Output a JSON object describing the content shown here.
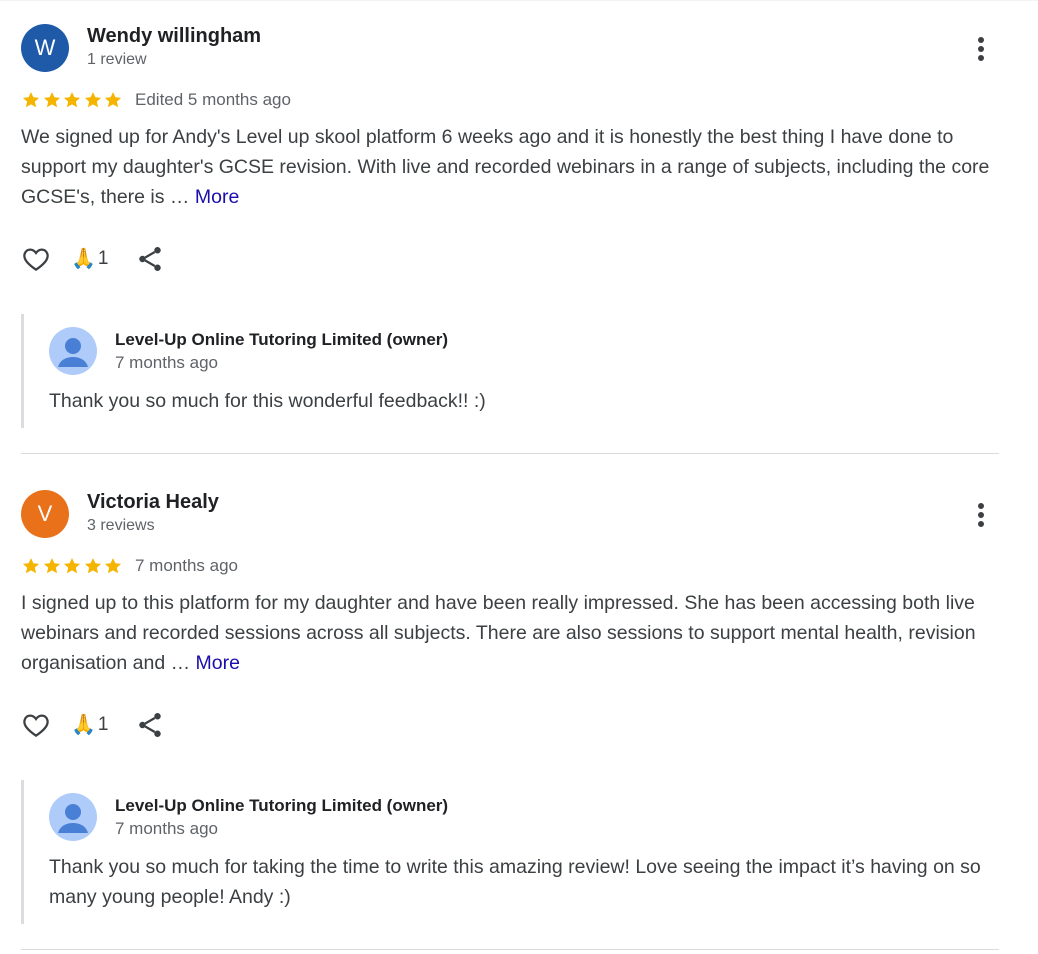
{
  "colors": {
    "star": "#f4b400",
    "link": "#1a0dab",
    "avatar_w": "#1e5aa8",
    "avatar_v": "#e8711a",
    "owner_avatar_bg": "#aecbfa",
    "owner_avatar_fg": "#4a7fd6"
  },
  "icons": [
    "star-icon",
    "heart-icon",
    "pray-icon",
    "share-icon",
    "more-vert-icon",
    "person-icon"
  ],
  "reviews": [
    {
      "initial": "W",
      "name": "Wendy willingham",
      "review_count": "1 review",
      "rating": 5,
      "date": "Edited 5 months ago",
      "text": "We signed up for Andy's Level up skool platform 6 weeks ago and it is honestly the best thing I have done to support my daughter's GCSE revision. With live and recorded webinars in a range of subjects, including the core GCSE's, there is …",
      "more": "More",
      "reaction_emoji": "🙏",
      "reaction_count": "1",
      "reply": {
        "name": "Level-Up Online Tutoring Limited (owner)",
        "date": "7 months ago",
        "text": "Thank you so much for this wonderful feedback!! :)"
      }
    },
    {
      "initial": "V",
      "name": "Victoria Healy",
      "review_count": "3 reviews",
      "rating": 5,
      "date": "7 months ago",
      "text": "I signed up to this platform for my daughter and have been really impressed. She has been accessing both live webinars and recorded sessions across all subjects. There are also sessions to support mental health, revision organisation and …",
      "more": "More",
      "reaction_emoji": "🙏",
      "reaction_count": "1",
      "reply": {
        "name": "Level-Up Online Tutoring Limited (owner)",
        "date": "7 months ago",
        "text": "Thank you so much for taking the time to write this amazing review! Love seeing the impact it’s having on so many young people! Andy :)"
      }
    }
  ]
}
